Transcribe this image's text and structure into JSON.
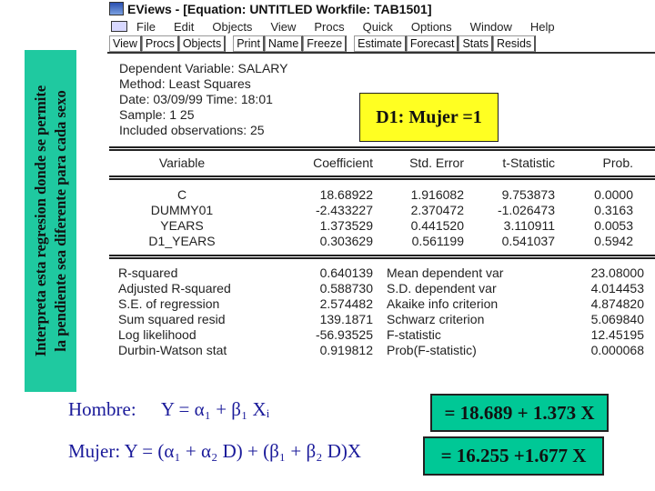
{
  "side_note": {
    "line1": "Interpreta esta regresion donde se permite",
    "line2": "la pendiente sea diferente para cada sexo"
  },
  "window": {
    "title": "EViews - [Equation: UNTITLED   Workfile: TAB1501]",
    "menu": [
      "File",
      "Edit",
      "Objects",
      "View",
      "Procs",
      "Quick",
      "Options",
      "Window",
      "Help"
    ],
    "toolbar": {
      "group1": [
        "View",
        "Procs",
        "Objects"
      ],
      "group2": [
        "Print",
        "Name",
        "Freeze"
      ],
      "group3": [
        "Estimate",
        "Forecast",
        "Stats",
        "Resids"
      ]
    }
  },
  "header": {
    "dependent": "Dependent Variable: SALARY",
    "method": "Method: Least Squares",
    "date": "Date: 03/09/99   Time: 18:01",
    "sample": "Sample: 1 25",
    "obs": "Included observations: 25"
  },
  "callout": "D1: Mujer =1",
  "coefficients": {
    "columns": [
      "Variable",
      "Coefficient",
      "Std. Error",
      "t-Statistic",
      "Prob."
    ],
    "rows": [
      [
        "C",
        "18.68922",
        "1.916082",
        "9.753873",
        "0.0000"
      ],
      [
        "DUMMY01",
        "-2.433227",
        "2.370472",
        "-1.026473",
        "0.3163"
      ],
      [
        "YEARS",
        "1.373529",
        "0.441520",
        "3.110911",
        "0.0053"
      ],
      [
        "D1_YEARS",
        "0.303629",
        "0.561199",
        "0.541037",
        "0.5942"
      ]
    ]
  },
  "stats": [
    [
      "R-squared",
      "0.640139",
      "Mean dependent var",
      "23.08000"
    ],
    [
      "Adjusted R-squared",
      "0.588730",
      "S.D. dependent var",
      "4.014453"
    ],
    [
      "S.E. of regression",
      "2.574482",
      "Akaike info criterion",
      "4.874820"
    ],
    [
      "Sum squared resid",
      "139.1871",
      "Schwarz criterion",
      "5.069840"
    ],
    [
      "Log likelihood",
      "-56.93525",
      "F-statistic",
      "12.45195"
    ],
    [
      "Durbin-Watson stat",
      "0.919812",
      "Prob(F-statistic)",
      "0.000068"
    ]
  ],
  "equations": {
    "hombre_label": "Hombre:",
    "hombre_formula": "Y = α₁ + β₁ Xᵢ",
    "hombre_result": "= 18.689 + 1.373 X",
    "mujer_label": "Mujer:",
    "mujer_formula": "Y = (α₁ + α₂ D) + (β₁ + β₂ D)X",
    "mujer_result": "= 16.255 +1.677 X"
  },
  "colors": {
    "note_bg": "#1fc9a0",
    "callout_bg": "#ffff22",
    "result_bg": "#00c896",
    "equation_text": "#1a1a9a"
  }
}
